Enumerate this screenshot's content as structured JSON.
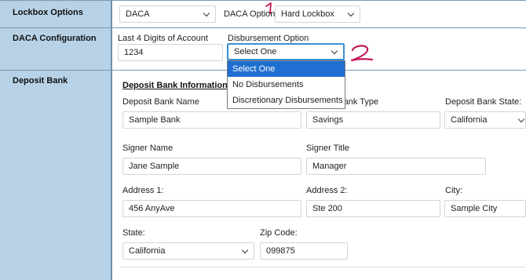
{
  "sections": {
    "lockbox": "Lockbox Options",
    "daca": "DACA Configuration",
    "deposit": "Deposit Bank"
  },
  "lockbox": {
    "daca_select": "DACA",
    "daca_option_label": "DACA Option",
    "daca_option_value": "Hard Lockbox"
  },
  "daca_config": {
    "last4_label": "Last 4 Digits of Account",
    "last4_value": "1234",
    "disb_label": "Disbursement Option",
    "disb_value": "Select One",
    "options": [
      "Select One",
      "No Disbursements",
      "Discretionary Disbursements"
    ]
  },
  "deposit": {
    "heading": "Deposit Bank Information",
    "name_label": "Deposit Bank Name",
    "name_value": "Sample Bank",
    "type_label": "Deposit Bank Type",
    "type_value": "Savings",
    "state_label": "Deposit Bank State:",
    "state_value": "California",
    "signer_name_label": "Signer Name",
    "signer_name_value": "Jane Sample",
    "signer_title_label": "Signer Title",
    "signer_title_value": "Manager",
    "addr1_label": "Address 1:",
    "addr1_value": "456 AnyAve",
    "addr2_label": "Address 2:",
    "addr2_value": "Ste 200",
    "city_label": "City:",
    "city_value": "Sample City",
    "state2_label": "State:",
    "state2_value": "California",
    "zip_label": "Zip Code:",
    "zip_value": "099875"
  },
  "annotations": {
    "one": "1",
    "two": "2",
    "color": "#c2185b"
  },
  "colors": {
    "sidebar": "#b7d2e6",
    "focus": "#3a8fd0",
    "selected_option": "#1e6fd1"
  }
}
